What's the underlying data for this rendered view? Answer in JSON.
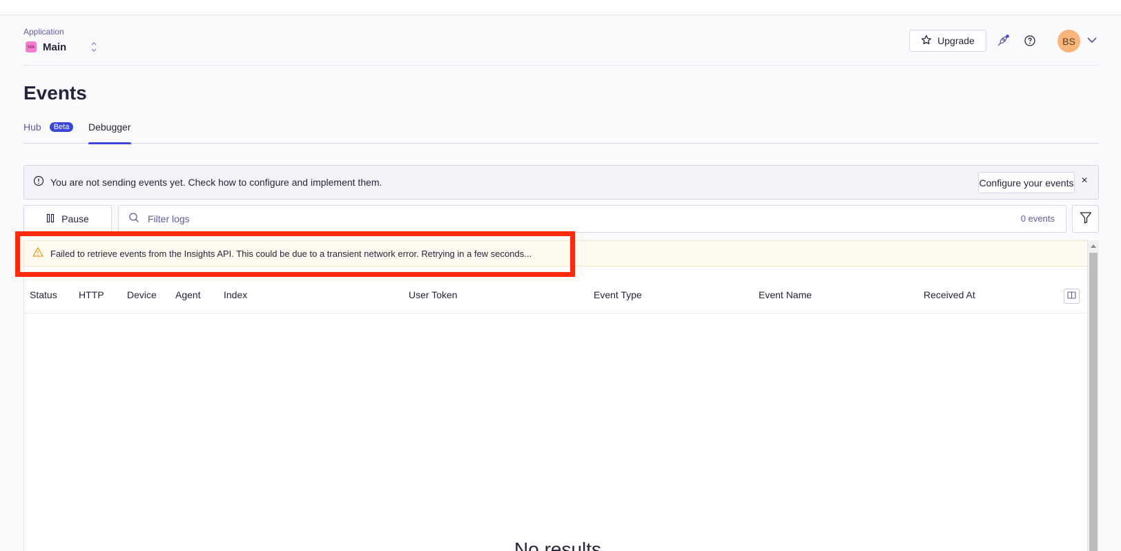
{
  "header": {
    "app_label": "Application",
    "app_badge": "MA",
    "app_name": "Main",
    "upgrade_label": "Upgrade",
    "avatar_initials": "BS"
  },
  "page": {
    "title": "Events",
    "tabs": [
      {
        "label": "Hub",
        "badge": "Beta",
        "active": false
      },
      {
        "label": "Debugger",
        "active": true
      }
    ]
  },
  "info_banner": {
    "text": "You are not sending events yet. Check how to configure and implement them.",
    "button_label": "Configure your events",
    "close_label": "×"
  },
  "toolbar": {
    "pause_label": "Pause",
    "search_placeholder": "Filter logs",
    "event_count": "0 events"
  },
  "warning": {
    "text": "Failed to retrieve events from the Insights API. This could be due to a transient network error. Retrying in a few seconds..."
  },
  "table": {
    "columns": [
      "Status",
      "HTTP",
      "Device",
      "Agent",
      "Index",
      "User Token",
      "Event Type",
      "Event Name",
      "Received At"
    ],
    "empty_text": "No results"
  },
  "colors": {
    "accent": "#3a46d8",
    "highlight": "#ff2a0c",
    "warning_icon": "#e8a030",
    "avatar": "#f8b57a"
  }
}
